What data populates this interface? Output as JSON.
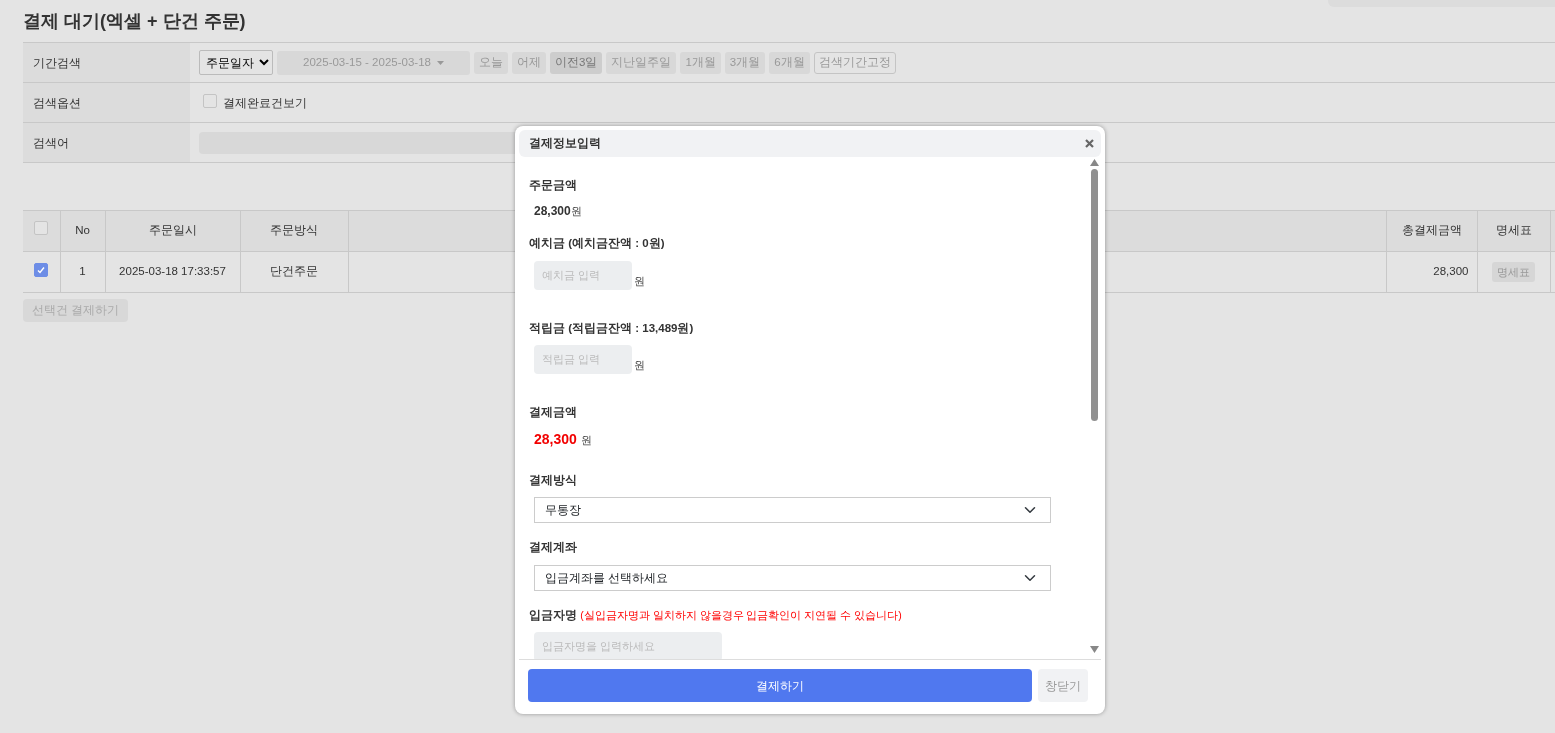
{
  "page_title": "결제 대기(엑셀 + 단건 주문)",
  "search_filters": [
    {
      "kind": "period",
      "label": "기간검색",
      "date_type": "주문일자",
      "date_range": "2025-03-15 - 2025-03-18",
      "presets": [
        {
          "label": "오늘",
          "selected": false
        },
        {
          "label": "어제",
          "selected": false
        },
        {
          "label": "이전3일",
          "selected": true
        },
        {
          "label": "지난일주일",
          "selected": false
        },
        {
          "label": "1개월",
          "selected": false
        },
        {
          "label": "3개월",
          "selected": false
        },
        {
          "label": "6개월",
          "selected": false
        }
      ],
      "fix_button": "검색기간고정"
    },
    {
      "kind": "option",
      "label": "검색옵션",
      "checkbox": {
        "label": "결제완료건보기",
        "checked": false
      }
    },
    {
      "kind": "keyword",
      "label": "검색어"
    }
  ],
  "table": {
    "columns": [
      {
        "kind": "checkbox",
        "checked": false
      },
      {
        "kind": "text",
        "label": "No"
      },
      {
        "kind": "text",
        "label": "주문일시"
      },
      {
        "kind": "text",
        "label": "주문방식"
      },
      {
        "kind": "blank"
      },
      {
        "kind": "text",
        "label": "총결제금액"
      },
      {
        "kind": "text",
        "label": "명세표"
      },
      {
        "kind": "blank"
      }
    ],
    "rows": [
      {
        "checked": true,
        "no": "1",
        "ordered_at": "2025-03-18 17:33:57",
        "order_type": "단건주문",
        "total": "28,300",
        "statement_button": "명세표"
      }
    ]
  },
  "bulk_pay_button": "선택건 결제하기",
  "modal": {
    "title": "결제정보입력",
    "sections": [
      {
        "kind": "amount",
        "label": "주문금액",
        "value": "28,300",
        "unit": "원",
        "highlight": false
      },
      {
        "kind": "input",
        "label": "**예치금 (예치금잔액 :** 0원)",
        "placeholder": "예치금 입력",
        "unit": "원"
      },
      {
        "kind": "input",
        "label": "**적립금 (적립금잔액 :** 13,489원)",
        "placeholder": "적립금 입력",
        "unit": "원"
      },
      {
        "kind": "amount",
        "label": "결제금액",
        "value": "28,300",
        "unit": "원",
        "highlight": true
      },
      {
        "kind": "select",
        "label": "결제방식",
        "value": "무통장"
      },
      {
        "kind": "select",
        "label": "결제계좌",
        "value": "입금계좌를 선택하세요"
      },
      {
        "kind": "wide_input",
        "label": "입금자명",
        "note": "(실입금자명과 일치하지 않을경우 입금확인이 지연될 수 있습니다)",
        "placeholder": "입금자명을 입력하세요"
      }
    ],
    "pay_button": "결제하기",
    "close_button": "창닫기"
  }
}
